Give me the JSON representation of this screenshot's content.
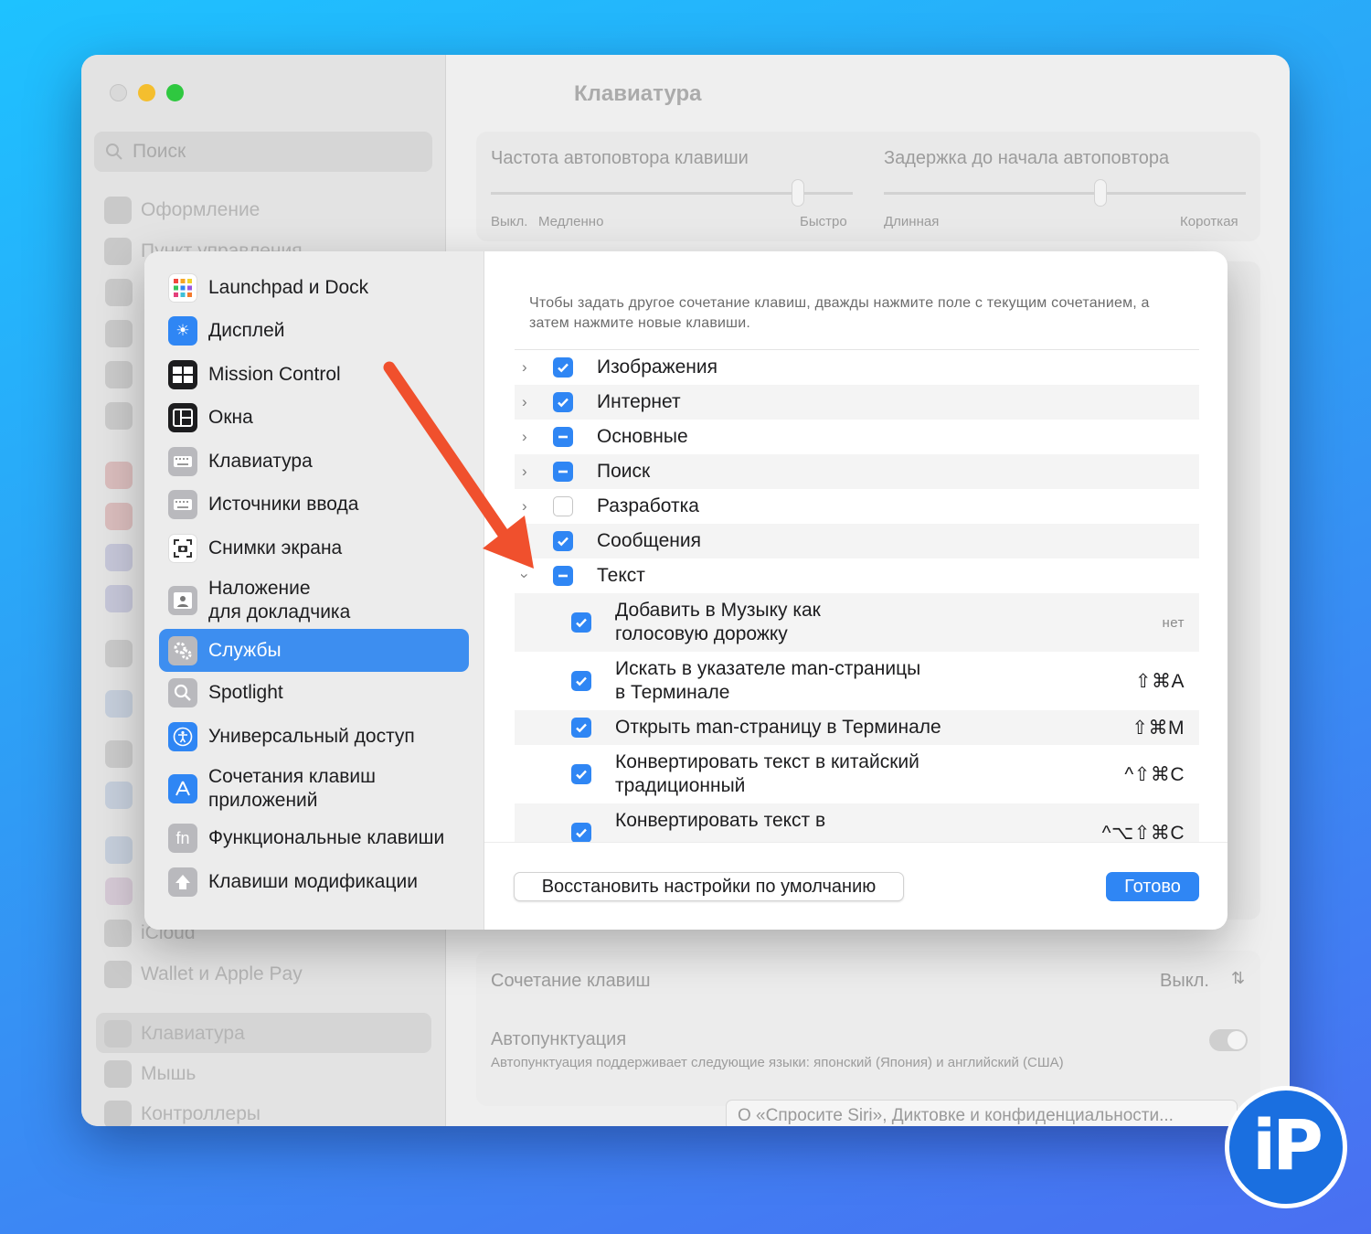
{
  "window": {
    "title": "Клавиатура",
    "search_placeholder": "Поиск",
    "sidebar_items": [
      {
        "label": "Оформление",
        "icon": "appearance-icon"
      },
      {
        "label": "Пункт управления",
        "icon": "control-center-icon"
      },
      {
        "label": "iCloud",
        "icon": "icloud-icon"
      },
      {
        "label": "Wallet и Apple Pay",
        "icon": "wallet-icon"
      },
      {
        "label": "Клавиатура",
        "icon": "keyboard-icon",
        "selected": true
      },
      {
        "label": "Мышь",
        "icon": "mouse-icon"
      },
      {
        "label": "Контроллеры",
        "icon": "controller-icon"
      }
    ],
    "main": {
      "repeat_rate_label": "Частота автоповтора клавиши",
      "repeat_rate_min": "Выкл.",
      "repeat_rate_slow": "Медленно",
      "repeat_rate_fast": "Быстро",
      "delay_label": "Задержка до начала автоповтора",
      "delay_long": "Длинная",
      "delay_short": "Короткая",
      "shortcut_label": "Сочетание клавиш",
      "shortcut_value": "Выкл.",
      "autopunct_label": "Автопунктуация",
      "autopunct_desc": "Автопунктуация поддерживает следующие языки: японский (Япония) и английский (США)",
      "siri_button": "О «Спросите Siri», Диктовке и конфиденциальности..."
    }
  },
  "sheet": {
    "sidebar": [
      {
        "label": "Launchpad и Dock",
        "icon": "launchpad-icon"
      },
      {
        "label": "Дисплей",
        "icon": "display-icon"
      },
      {
        "label": "Mission Control",
        "icon": "mission-control-icon"
      },
      {
        "label": "Окна",
        "icon": "windows-icon"
      },
      {
        "label": "Клавиатура",
        "icon": "keyboard-icon"
      },
      {
        "label": "Источники ввода",
        "icon": "input-sources-icon"
      },
      {
        "label": "Снимки экрана",
        "icon": "screenshot-icon"
      },
      {
        "label": "Наложение\nдля докладчика",
        "icon": "presenter-overlay-icon"
      },
      {
        "label": "Службы",
        "icon": "services-icon",
        "selected": true
      },
      {
        "label": "Spotlight",
        "icon": "spotlight-icon"
      },
      {
        "label": "Универсальный доступ",
        "icon": "accessibility-icon"
      },
      {
        "label": "Сочетания клавиш\nприложений",
        "icon": "app-shortcuts-icon"
      },
      {
        "label": "Функциональные клавиши",
        "icon": "fn-icon",
        "glyph": "fn"
      },
      {
        "label": "Клавиши модификации",
        "icon": "modifier-keys-icon"
      }
    ],
    "hint": "Чтобы задать другое сочетание клавиш, дважды нажмите поле с текущим сочетанием, а затем нажмите новые клавиши.",
    "categories": [
      {
        "label": "Изображения",
        "state": "on",
        "expanded": false
      },
      {
        "label": "Интернет",
        "state": "on",
        "expanded": false
      },
      {
        "label": "Основные",
        "state": "mixed",
        "expanded": false
      },
      {
        "label": "Поиск",
        "state": "mixed",
        "expanded": false
      },
      {
        "label": "Разработка",
        "state": "off",
        "expanded": false
      },
      {
        "label": "Сообщения",
        "state": "on",
        "expanded": false
      },
      {
        "label": "Текст",
        "state": "mixed",
        "expanded": true
      }
    ],
    "text_services": [
      {
        "label": "Добавить в Музыку как\nголосовую дорожку",
        "shortcut": "нет",
        "checked": true
      },
      {
        "label": "Искать в указателе man-страницы\nв Терминале",
        "shortcut": "⇧⌘A",
        "checked": true
      },
      {
        "label": "Открыть man-страницу в Терминале",
        "shortcut": "⇧⌘M",
        "checked": true
      },
      {
        "label": "Конвертировать текст в китайский\nтрадиционный",
        "shortcut": "^⇧⌘C",
        "checked": true
      },
      {
        "label": "Конвертировать текст в",
        "shortcut": "^⌥⇧⌘C",
        "checked": true
      }
    ],
    "reset_button": "Восстановить настройки по умолчанию",
    "done_button": "Готово"
  },
  "annotation_arrow_color": "#f0502d",
  "accent_color": "#2f86f4",
  "watermark": "iP"
}
